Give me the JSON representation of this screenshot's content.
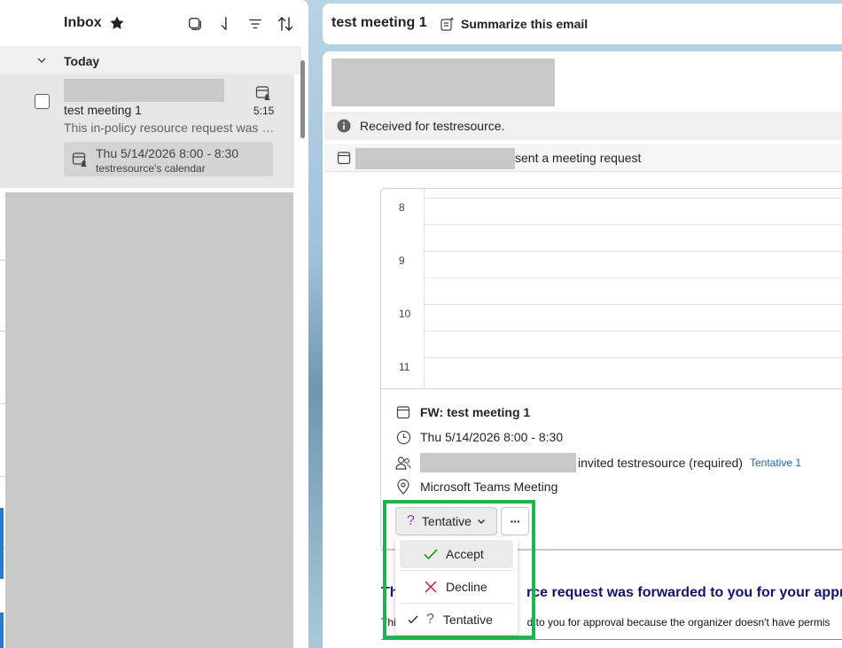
{
  "mail_list": {
    "folder_title": "Inbox",
    "group_label": "Today",
    "message": {
      "subject": "test meeting 1",
      "time": "5:15",
      "preview": "This in-policy resource request was f...",
      "calendar_card": {
        "time": "Thu 5/14/2026 8:00 - 8:30",
        "calendar": "testresource's calendar"
      }
    }
  },
  "reading_pane": {
    "subject": "test meeting 1",
    "summarize_label": "Summarize this email",
    "info_text": "Received for testresource.",
    "sent_text": "sent a meeting request",
    "calendar_hours": [
      "8",
      "9",
      "10",
      "11"
    ],
    "details": {
      "title": "FW: test meeting 1",
      "time": "Thu 5/14/2026 8:00 - 8:30",
      "invited_text": "invited testresource (required)",
      "tentative_count": "Tentative 1",
      "location": "Microsoft Teams Meeting"
    },
    "rsvp": {
      "button_label": "Tentative",
      "button_icon": "?",
      "more_label": "···",
      "menu": [
        {
          "label": "Accept",
          "icon": "checkmark-icon",
          "color": "#107c10"
        },
        {
          "label": "Decline",
          "icon": "dismiss-icon",
          "color": "#c50f1f"
        },
        {
          "label": "Tentative",
          "icon": "question-icon",
          "color": "#8a3fc2",
          "selected": true
        }
      ]
    },
    "body": {
      "heading_visible": "Thi",
      "heading_tail": "rce request was forwarded to you for your approv",
      "text_visible": "Thi",
      "text_tail": "d to you for approval because the organizer doesn't have permis"
    }
  },
  "colors": {
    "highlight": "#22b14c",
    "link": "#0f6cbd",
    "heading": "#12136e"
  }
}
